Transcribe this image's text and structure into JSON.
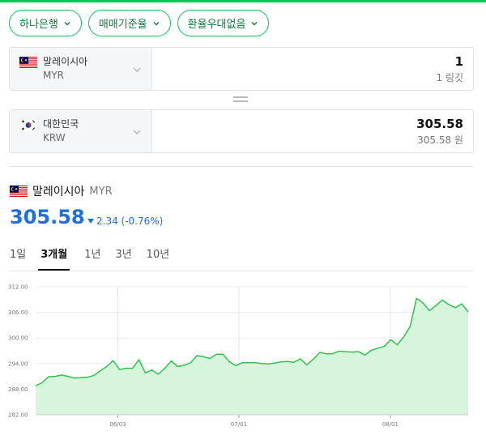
{
  "filters": [
    {
      "label": "하나은행"
    },
    {
      "label": "매매기준율"
    },
    {
      "label": "환율우대없음"
    }
  ],
  "from": {
    "name": "말레이시아",
    "code": "MYR",
    "amount": "1",
    "unit": "1 링깃"
  },
  "to": {
    "name": "대한민국",
    "code": "KRW",
    "amount": "305.58",
    "unit": "305.58 원"
  },
  "currency": {
    "name": "말레이시아",
    "code": "MYR",
    "rate": "305.58",
    "change": "2.34 (-0.76%)"
  },
  "tabs": [
    {
      "label": "1일",
      "active": false
    },
    {
      "label": "3개월",
      "active": true
    },
    {
      "label": "1년",
      "active": false
    },
    {
      "label": "3년",
      "active": false
    },
    {
      "label": "10년",
      "active": false
    }
  ],
  "colors": {
    "accent": "#03c75a",
    "rate": "#1e6ee6",
    "line": "#2ec24d",
    "fill": "#d6f5dc"
  },
  "chart_data": {
    "type": "area",
    "y_ticks": [
      "312.00",
      "306.00",
      "300.00",
      "294.00",
      "288.00",
      "282.00"
    ],
    "x_ticks": [
      "06/03",
      "07/01",
      "08/01"
    ],
    "ylim": [
      282,
      312
    ],
    "grid": true,
    "values": [
      288.8,
      289.5,
      290.9,
      291.0,
      291.3,
      291.0,
      290.6,
      290.7,
      290.8,
      291.2,
      292.3,
      293.3,
      294.7,
      292.6,
      292.9,
      292.9,
      294.9,
      291.8,
      292.5,
      291.5,
      292.9,
      294.6,
      293.3,
      293.6,
      294.2,
      295.9,
      295.6,
      295.2,
      296.2,
      296.2,
      294.4,
      293.5,
      294.2,
      294.2,
      294.2,
      294.0,
      293.9,
      294.1,
      294.4,
      294.5,
      294.3,
      295.1,
      293.7,
      295.0,
      296.6,
      296.3,
      296.3,
      296.9,
      296.8,
      296.7,
      296.8,
      296.0,
      297.1,
      297.6,
      298.0,
      299.6,
      298.4,
      300.2,
      302.7,
      309.3,
      308.2,
      306.4,
      307.6,
      308.9,
      307.8,
      307.1,
      308.0,
      306.1
    ]
  }
}
